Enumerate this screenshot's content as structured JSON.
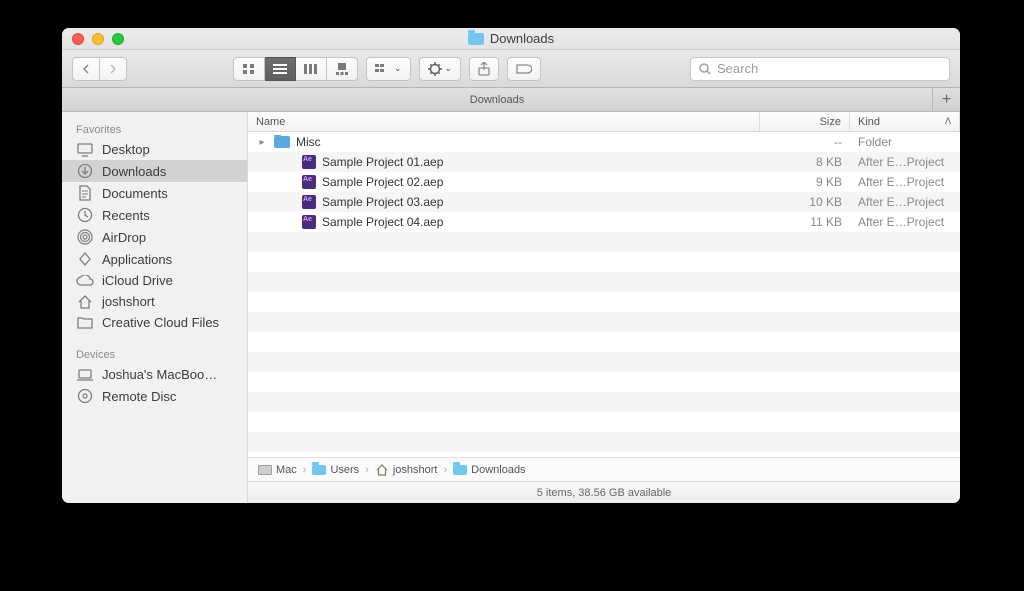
{
  "window": {
    "title": "Downloads"
  },
  "search": {
    "placeholder": "Search"
  },
  "tabbar": {
    "tab": "Downloads"
  },
  "sidebar": {
    "favorites_label": "Favorites",
    "devices_label": "Devices",
    "favorites": [
      {
        "label": "Desktop",
        "icon": "desktop"
      },
      {
        "label": "Downloads",
        "icon": "downloads",
        "selected": true
      },
      {
        "label": "Documents",
        "icon": "documents"
      },
      {
        "label": "Recents",
        "icon": "recents"
      },
      {
        "label": "AirDrop",
        "icon": "airdrop"
      },
      {
        "label": "Applications",
        "icon": "applications"
      },
      {
        "label": "iCloud Drive",
        "icon": "cloud"
      },
      {
        "label": "joshshort",
        "icon": "home"
      },
      {
        "label": "Creative Cloud Files",
        "icon": "folder"
      }
    ],
    "devices": [
      {
        "label": "Joshua's MacBoo…",
        "icon": "laptop"
      },
      {
        "label": "Remote Disc",
        "icon": "disc"
      }
    ]
  },
  "columns": {
    "name": "Name",
    "size": "Size",
    "kind": "Kind"
  },
  "rows": [
    {
      "name": "Misc",
      "size": "--",
      "kind": "Folder",
      "type": "folder",
      "expandable": true
    },
    {
      "name": "Sample Project 01.aep",
      "size": "8 KB",
      "kind": "After E…Project",
      "type": "aep"
    },
    {
      "name": "Sample Project 02.aep",
      "size": "9 KB",
      "kind": "After E…Project",
      "type": "aep"
    },
    {
      "name": "Sample Project 03.aep",
      "size": "10 KB",
      "kind": "After E…Project",
      "type": "aep"
    },
    {
      "name": "Sample Project 04.aep",
      "size": "11 KB",
      "kind": "After E…Project",
      "type": "aep"
    }
  ],
  "path": [
    {
      "label": "Mac",
      "icon": "hdd"
    },
    {
      "label": "Users",
      "icon": "folder"
    },
    {
      "label": "joshshort",
      "icon": "home"
    },
    {
      "label": "Downloads",
      "icon": "folder"
    }
  ],
  "status": "5 items, 38.56 GB available"
}
